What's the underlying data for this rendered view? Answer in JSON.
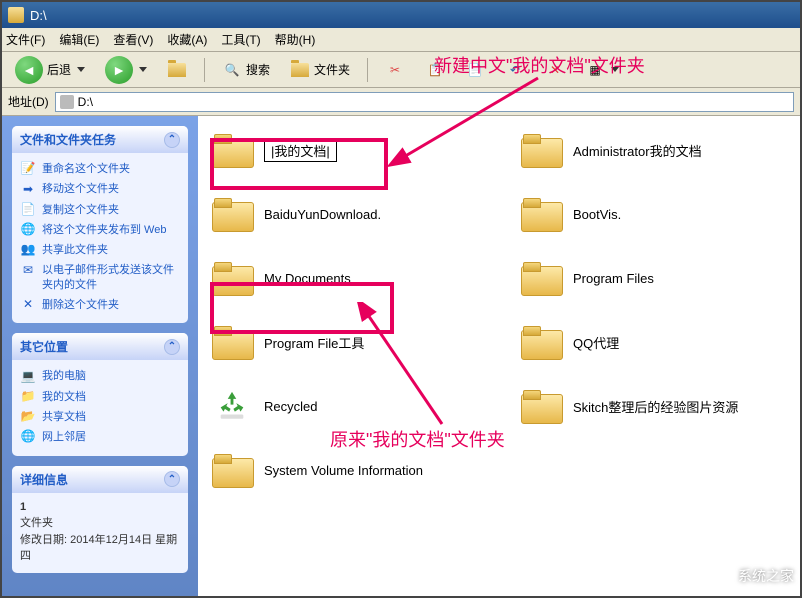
{
  "title": "D:\\",
  "menu": {
    "file": "文件(F)",
    "edit": "编辑(E)",
    "view": "查看(V)",
    "favorites": "收藏(A)",
    "tools": "工具(T)",
    "help": "帮助(H)"
  },
  "toolbar": {
    "back": "后退",
    "search": "搜索",
    "folders": "文件夹"
  },
  "address": {
    "label": "地址(D)",
    "value": "D:\\"
  },
  "side_tasks": {
    "title": "文件和文件夹任务",
    "items": [
      "重命名这个文件夹",
      "移动这个文件夹",
      "复制这个文件夹",
      "将这个文件夹发布到 Web",
      "共享此文件夹",
      "以电子邮件形式发送该文件夹内的文件",
      "删除这个文件夹"
    ]
  },
  "side_places": {
    "title": "其它位置",
    "items": [
      "我的电脑",
      "我的文档",
      "共享文档",
      "网上邻居"
    ]
  },
  "side_details": {
    "title": "详细信息",
    "name": "1",
    "type": "文件夹",
    "modified_label": "修改日期:",
    "modified": "2014年12月14日 星期四"
  },
  "folders": [
    {
      "name": "我的文档",
      "editing": true
    },
    {
      "name": "Administrator我的文档"
    },
    {
      "name": "BaiduYunDownload."
    },
    {
      "name": "BootVis."
    },
    {
      "name": "My Documents"
    },
    {
      "name": "Program Files"
    },
    {
      "name": "Program File工具"
    },
    {
      "name": "QQ代理"
    },
    {
      "name": "Recycled",
      "recycle": true
    },
    {
      "name": "Skitch整理后的经验图片资源"
    },
    {
      "name": "System Volume Information"
    }
  ],
  "annotations": {
    "top": "新建中文\"我的文档\"文件夹",
    "bottom": "原来\"我的文档\"文件夹"
  },
  "watermark": "系统之家"
}
